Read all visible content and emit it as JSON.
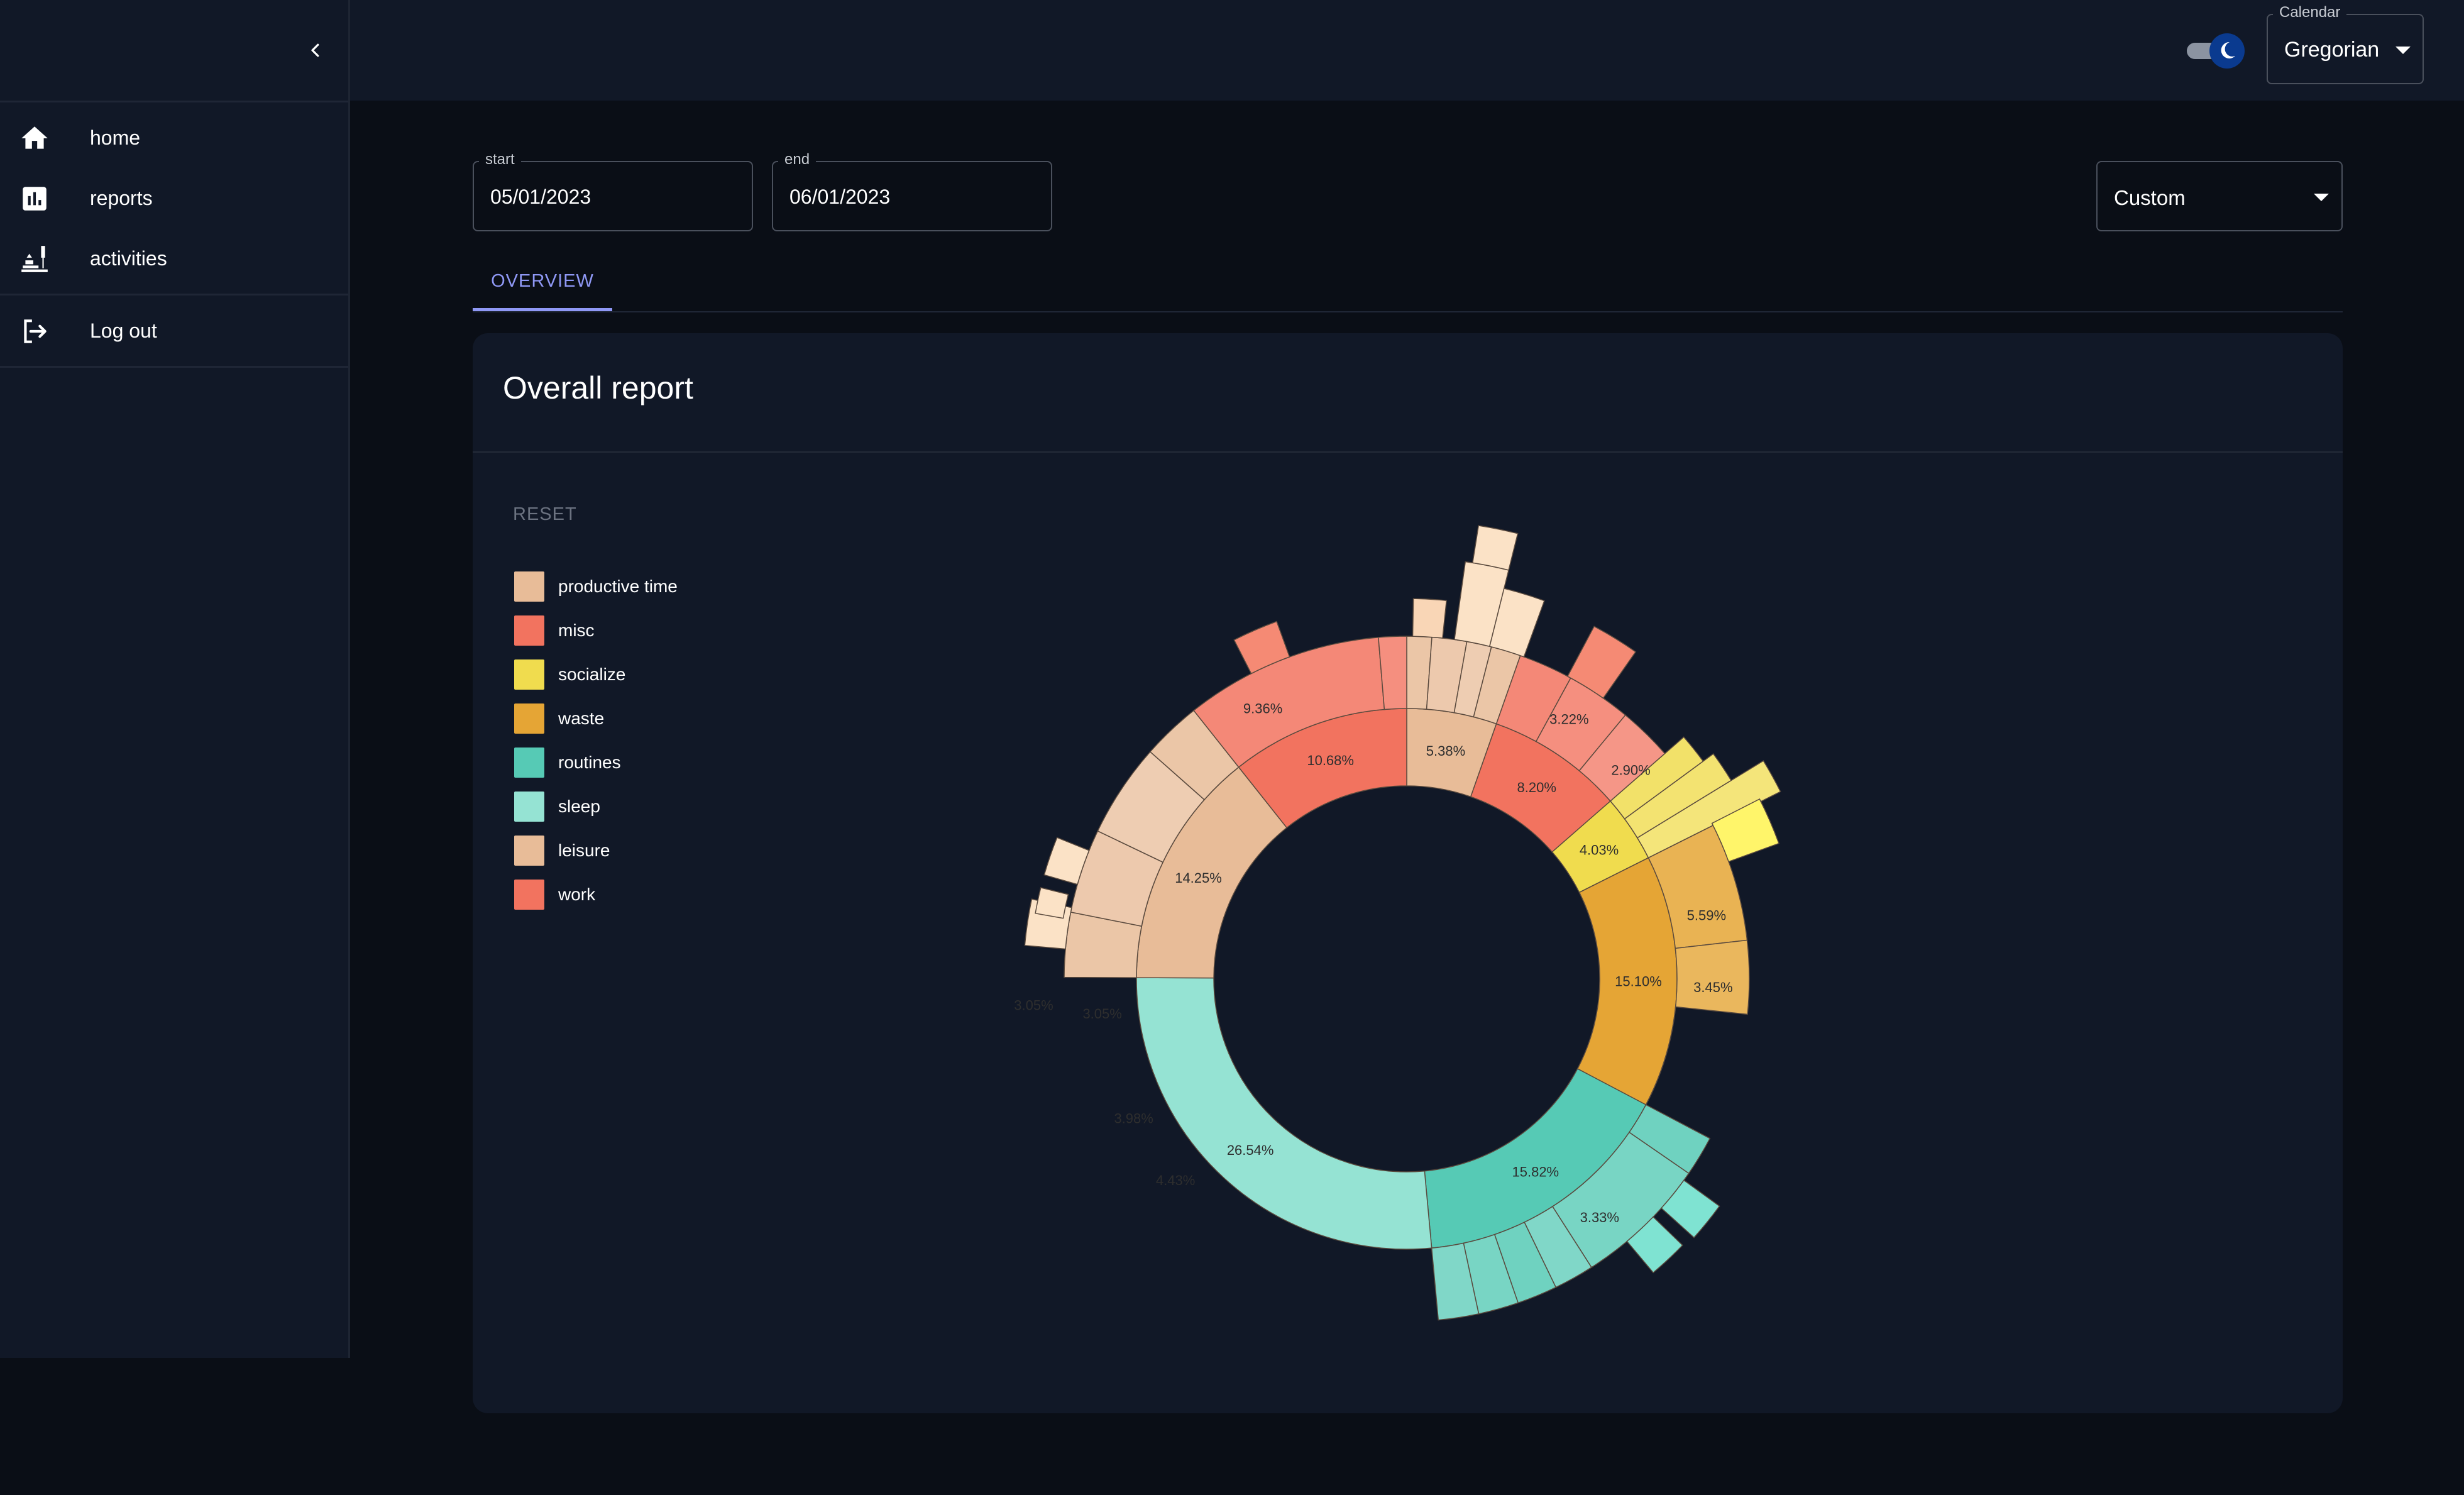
{
  "sidebar": {
    "items": [
      {
        "label": "home",
        "icon": "home-icon"
      },
      {
        "label": "reports",
        "icon": "bar-chart-icon"
      },
      {
        "label": "activities",
        "icon": "activities-icon"
      }
    ],
    "logout_label": "Log out"
  },
  "topbar": {
    "theme": "dark",
    "calendar": {
      "label": "Calendar",
      "value": "Gregorian"
    }
  },
  "filters": {
    "start": {
      "label": "start",
      "value": "05/01/2023"
    },
    "end": {
      "label": "end",
      "value": "06/01/2023"
    },
    "range": {
      "value": "Custom"
    }
  },
  "tabs": [
    {
      "label": "OVERVIEW",
      "active": true
    }
  ],
  "report": {
    "title": "Overall report",
    "reset_label": "RESET",
    "legend": [
      {
        "label": "productive time",
        "color": "#E8BC98"
      },
      {
        "label": "misc",
        "color": "#F2735F"
      },
      {
        "label": "socialize",
        "color": "#F0DC4E"
      },
      {
        "label": "waste",
        "color": "#E5A535"
      },
      {
        "label": "routines",
        "color": "#56CAB5"
      },
      {
        "label": "sleep",
        "color": "#95E3D3"
      },
      {
        "label": "leisure",
        "color": "#E8BC98"
      },
      {
        "label": "work",
        "color": "#F2735F"
      }
    ]
  },
  "colors": {
    "background": "#0A0E16",
    "surface": "#111827",
    "accent": "#8F98F5"
  },
  "chart_data": {
    "type": "sunburst",
    "inner_ring": [
      {
        "category": "leisure",
        "value": 5.38,
        "label": "5.38%",
        "color": "#E8BC98"
      },
      {
        "category": "misc",
        "value": 8.2,
        "label": "8.20%",
        "color": "#F2735F"
      },
      {
        "category": "socialize",
        "value": 4.03,
        "label": "4.03%",
        "color": "#F0DC4E"
      },
      {
        "category": "waste",
        "value": 15.1,
        "label": "15.10%",
        "color": "#E5A535"
      },
      {
        "category": "routines",
        "value": 15.82,
        "label": "15.82%",
        "color": "#56CAB5"
      },
      {
        "category": "sleep",
        "value": 26.54,
        "label": "26.54%",
        "color": "#95E3D3"
      },
      {
        "category": "productive time",
        "value": 14.25,
        "label": "14.25%",
        "color": "#E8BC98"
      },
      {
        "category": "work",
        "value": 10.68,
        "label": "10.68%",
        "color": "#F2735F"
      }
    ],
    "segment_labels": [
      {
        "value": 3.22,
        "label": "3.22%",
        "parent": "misc"
      },
      {
        "value": 2.9,
        "label": "2.90%",
        "parent": "misc"
      },
      {
        "value": 5.59,
        "label": "5.59%",
        "parent": "waste"
      },
      {
        "value": 3.45,
        "label": "3.45%",
        "parent": "waste"
      },
      {
        "value": 3.33,
        "label": "3.33%",
        "parent": "routines"
      },
      {
        "value": 3.05,
        "label": "3.05%",
        "parent": "productive time"
      },
      {
        "value": 3.98,
        "label": "3.98%",
        "parent": "productive time"
      },
      {
        "value": 4.43,
        "label": "4.43%",
        "parent": "productive time"
      },
      {
        "value": 3.05,
        "label": "3.05%",
        "parent": "productive time"
      },
      {
        "value": 9.36,
        "label": "9.36%",
        "parent": "work"
      }
    ]
  }
}
